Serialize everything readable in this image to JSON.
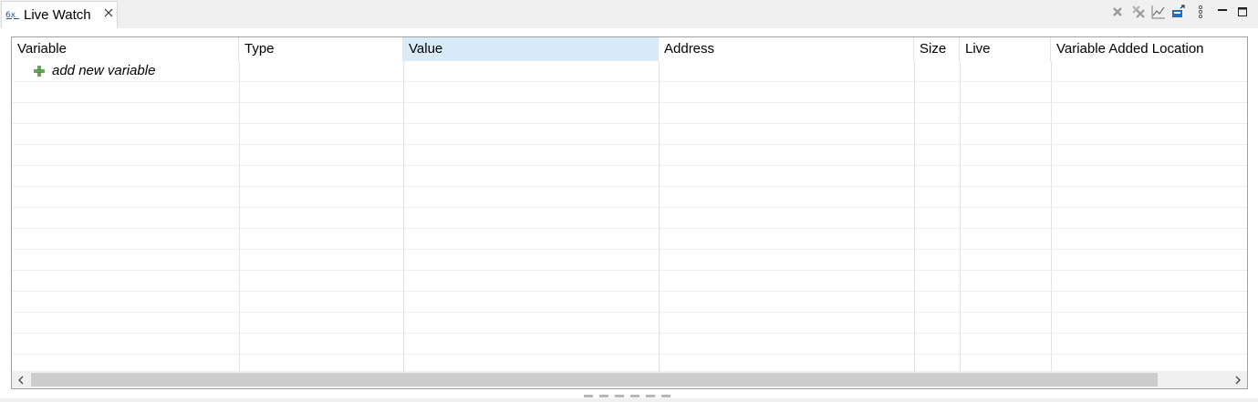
{
  "view": {
    "tab_title": "Live Watch",
    "tab_icon": "watch-variables-icon",
    "close_icon": "close-icon"
  },
  "toolbar": {
    "items": [
      {
        "name": "remove-variable-icon"
      },
      {
        "name": "remove-all-variables-icon"
      },
      {
        "name": "graph-icon"
      },
      {
        "name": "export-icon"
      },
      {
        "name": "view-menu-icon"
      },
      {
        "name": "minimize-icon"
      },
      {
        "name": "maximize-icon"
      }
    ]
  },
  "table": {
    "columns": [
      {
        "label": "Variable"
      },
      {
        "label": "Type"
      },
      {
        "label": "Value",
        "sorted": true
      },
      {
        "label": "Address"
      },
      {
        "label": "Size"
      },
      {
        "label": "Live"
      },
      {
        "label": "Variable Added Location"
      }
    ],
    "add_row_label": "add new variable",
    "add_row_icon": "add-icon"
  },
  "colors": {
    "sorted_header": "#d9ebf9",
    "add_icon": "#6aa84f",
    "remove_icon": "#9a9a9a",
    "export_icon": "#1e6fc8"
  }
}
